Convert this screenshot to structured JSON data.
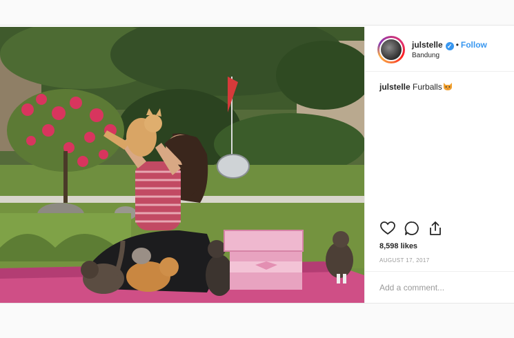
{
  "post": {
    "username": "julstelle",
    "verified_icon": "verified-badge-icon",
    "separator": "•",
    "follow_label": "Follow",
    "location": "Bandung",
    "caption_user": "julstelle",
    "caption_text": "Furballs",
    "caption_emoji": "cat-face-emoji",
    "likes": "8,598 likes",
    "date": "AUGUST 17, 2017",
    "comment_placeholder": "Add a comment..."
  },
  "actions": {
    "like_icon": "heart-icon",
    "comment_icon": "comment-icon",
    "share_icon": "share-icon"
  },
  "colors": {
    "accent": "#3897f0",
    "text": "#262626",
    "muted": "#999999",
    "border": "#efefef"
  }
}
